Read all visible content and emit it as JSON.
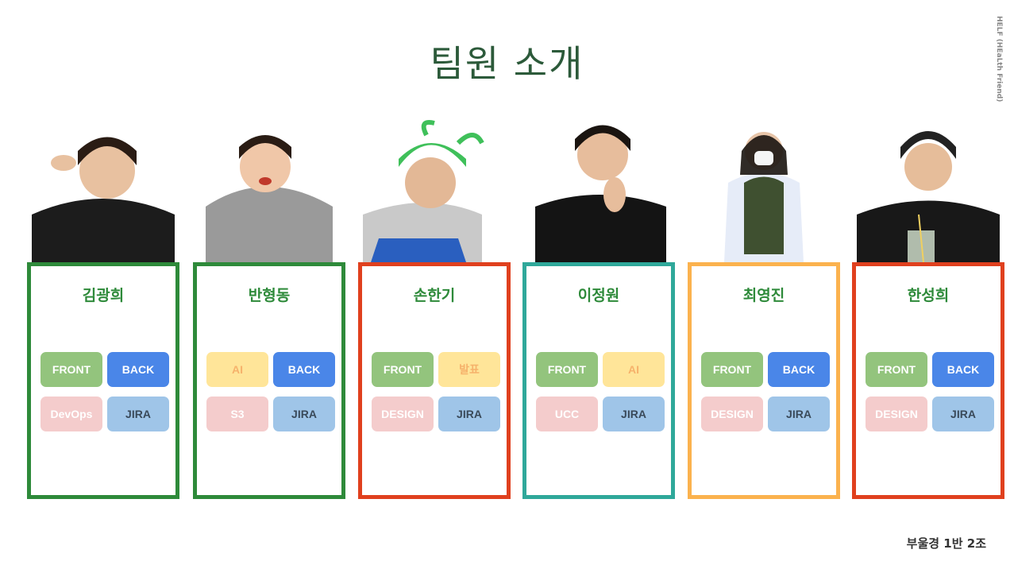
{
  "title": "팀원 소개",
  "side_text": "HELF (HEaLth Friend)",
  "footer": "부울경 1반 2조",
  "members": [
    {
      "name": "김광희",
      "border": "#2e8a3a",
      "tags": [
        "FRONT",
        "BACK",
        "DevOps",
        "JIRA"
      ]
    },
    {
      "name": "반형동",
      "border": "#2e8a3a",
      "tags": [
        "AI",
        "BACK",
        "S3",
        "JIRA"
      ]
    },
    {
      "name": "손한기",
      "border": "#e0401e",
      "tags": [
        "FRONT",
        "발표",
        "DESIGN",
        "JIRA"
      ]
    },
    {
      "name": "이정원",
      "border": "#2fa89a",
      "tags": [
        "FRONT",
        "AI",
        "UCC",
        "JIRA"
      ]
    },
    {
      "name": "최영진",
      "border": "#fbb24e",
      "tags": [
        "FRONT",
        "BACK",
        "DESIGN",
        "JIRA"
      ]
    },
    {
      "name": "한성희",
      "border": "#e0401e",
      "tags": [
        "FRONT",
        "BACK",
        "DESIGN",
        "JIRA"
      ]
    }
  ],
  "colors": {
    "name_green": "#2e8a3a",
    "front": "#93c47d",
    "back": "#4a86e8",
    "pink": "#f4cccc",
    "jira": "#9fc5e8",
    "yellow": "#ffe599"
  }
}
